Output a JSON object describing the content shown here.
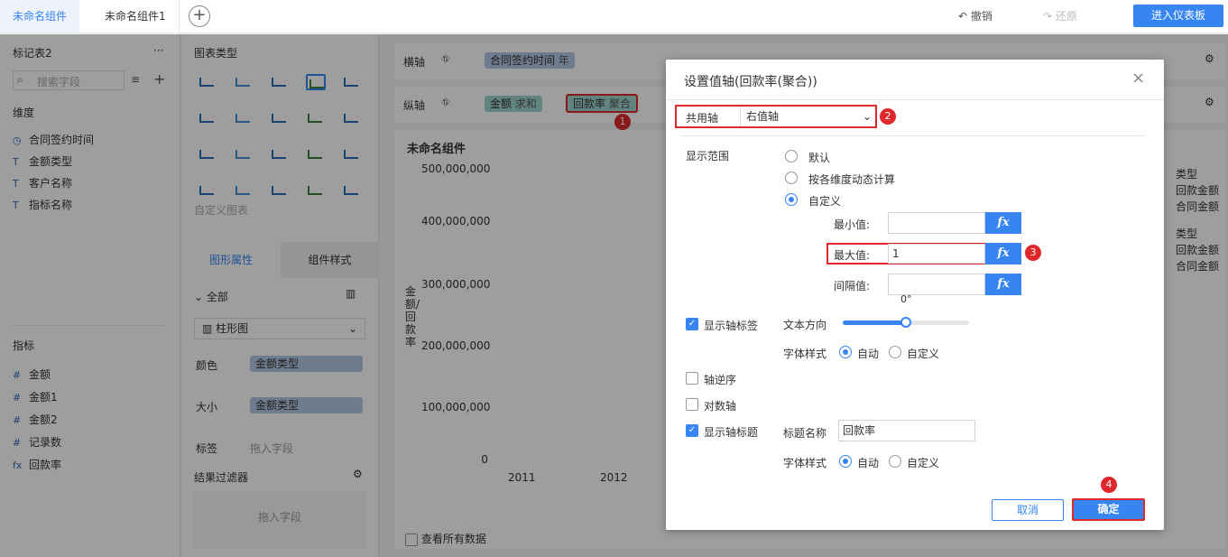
{
  "topbar": {
    "tab_active": "未命名组件",
    "tab_2": "未命名组件1",
    "add": "+",
    "undo": "撤销",
    "redo": "还原",
    "enter_dashboard": "进入仪表板"
  },
  "left": {
    "table_name": "标记表2",
    "more": "···",
    "search_placeholder": "搜索字段",
    "dim_title": "维度",
    "dims": [
      {
        "icon": "◷",
        "label": "合同签约时间"
      },
      {
        "icon": "T",
        "label": "金额类型"
      },
      {
        "icon": "T",
        "label": "客户名称"
      },
      {
        "icon": "T",
        "label": "指标名称"
      }
    ],
    "ind_title": "指标",
    "inds": [
      {
        "icon": "#",
        "label": "金额"
      },
      {
        "icon": "#",
        "label": "金额1"
      },
      {
        "icon": "#",
        "label": "金额2"
      },
      {
        "icon": "#",
        "label": "记录数"
      },
      {
        "icon": "fx",
        "label": "回款率"
      }
    ]
  },
  "mid": {
    "chart_type_title": "图表类型",
    "custom_chart": "自定义图表",
    "tab_graph": "图形属性",
    "tab_style": "组件样式",
    "all": "全部",
    "chart_select": "柱形图",
    "color_label": "颜色",
    "color_field": "金额类型",
    "size_label": "大小",
    "size_field": "金额类型",
    "tag_label": "标签",
    "drag_field": "拖入字段",
    "filter_title": "结果过滤器",
    "filter_drop": "拖入字段"
  },
  "canvas": {
    "x_axis_label": "横轴",
    "x_pill": "合同签约时间",
    "x_pill_sub": "年",
    "y_axis_label": "纵轴",
    "y_pill1": "金额",
    "y_pill1_sub": "求和",
    "y_pill2": "回款率",
    "y_pill2_sub": "聚合",
    "component_title": "未命名组件",
    "y_ticks": [
      "500,000,000",
      "400,000,000",
      "300,000,000",
      "200,000,000",
      "100,000,000",
      "0"
    ],
    "y_title": "金额/回款率",
    "x_ticks": [
      "2011",
      "2012"
    ],
    "legend": [
      "类型",
      "回款金额",
      "合同金额",
      "类型",
      "回款金额",
      "合同金额"
    ],
    "view_all": "查看所有数据"
  },
  "modal": {
    "title": "设置值轴(回款率(聚合))",
    "close": "×",
    "shared_axis_label": "共用轴",
    "shared_axis_value": "右值轴",
    "range_label": "显示范围",
    "opt_default": "默认",
    "opt_dynamic": "按各维度动态计算",
    "opt_custom": "自定义",
    "min_label": "最小值:",
    "max_label": "最大值:",
    "max_value": "1",
    "interval_label": "间隔值:",
    "fx": "fx",
    "degree": "0°",
    "show_axis_label": "显示轴标签",
    "text_dir": "文本方向",
    "font_style": "字体样式",
    "auto": "自动",
    "custom": "自定义",
    "reverse_axis": "轴逆序",
    "log_axis": "对数轴",
    "show_axis_title": "显示轴标题",
    "title_name": "标题名称",
    "title_value": "回款率",
    "cancel": "取消",
    "ok": "确定",
    "badges": [
      "1",
      "2",
      "3",
      "4"
    ]
  }
}
